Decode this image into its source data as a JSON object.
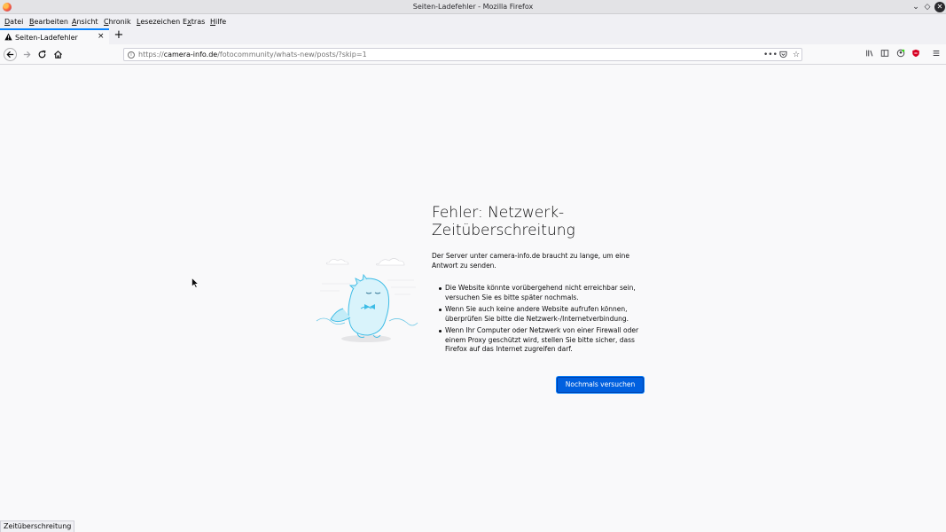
{
  "window": {
    "title": "Seiten-Ladefehler - Mozilla Firefox"
  },
  "menubar": {
    "items": [
      {
        "label": "Datei",
        "u": "D",
        "rest": "atei"
      },
      {
        "label": "Bearbeiten",
        "u": "B",
        "rest": "earbeiten"
      },
      {
        "label": "Ansicht",
        "u": "A",
        "rest": "nsicht"
      },
      {
        "label": "Chronik",
        "u": "C",
        "rest": "hronik"
      },
      {
        "label": "Lesezeichen",
        "u": "L",
        "rest": "esezeichen"
      },
      {
        "label": "Extras",
        "u": "x",
        "pre": "E",
        "rest": "tras"
      },
      {
        "label": "Hilfe",
        "u": "H",
        "rest": "ilfe"
      }
    ]
  },
  "tab": {
    "label": "Seiten-Ladefehler",
    "close": "×",
    "icon": "warning-icon"
  },
  "newtab": "+",
  "urlbar": {
    "scheme": "https://",
    "host": "camera-info.de",
    "path": "/fotocommunity/whats-new/posts/?skip=1"
  },
  "error": {
    "title": "Fehler: Netzwerk-Zeitüberschreitung",
    "description": "Der Server unter camera-info.de braucht zu lange, um eine Antwort zu senden.",
    "bullets": [
      "Die Website könnte vorübergehend nicht erreichbar sein, versuchen Sie es bitte später nochmals.",
      "Wenn Sie auch keine andere Website aufrufen können, überprüfen Sie bitte die Netzwerk-/Internetverbindung.",
      "Wenn Ihr Computer oder Netzwerk von einer Firewall oder einem Proxy geschützt wird, stellen Sie bitte sicher, dass Firefox auf das Internet zugreifen darf."
    ],
    "retry_label": "Nochmals versuchen"
  },
  "status": {
    "text": "Zeitüberschreitung"
  },
  "colors": {
    "accent": "#0060df",
    "tab_highlight": "#0a84ff",
    "background": "#f9f9fa"
  }
}
